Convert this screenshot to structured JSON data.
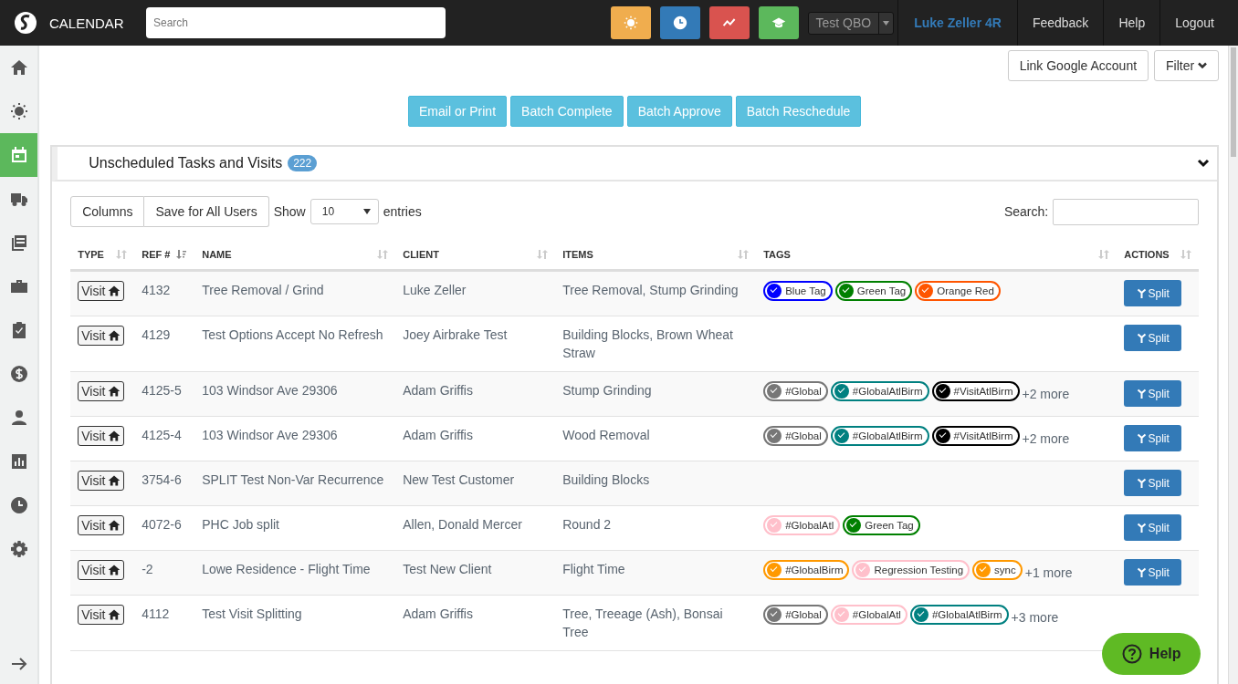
{
  "topbar": {
    "title": "CALENDAR",
    "search": {
      "placeholder": "Search"
    },
    "quick_buttons": [
      {
        "kind": "sun",
        "color": "#f0ad4e"
      },
      {
        "kind": "clock",
        "color": "#337ab7"
      },
      {
        "kind": "trend",
        "color": "#d9534f"
      },
      {
        "kind": "cap",
        "color": "#5cb85c"
      }
    ],
    "company_select": "Test QBO",
    "user": "Luke Zeller 4R",
    "links": [
      "Feedback",
      "Help",
      "Logout"
    ]
  },
  "sidebar": {
    "items": [
      {
        "kind": "home",
        "selected": false
      },
      {
        "kind": "sun",
        "selected": false
      },
      {
        "kind": "calendar",
        "selected": true
      },
      {
        "kind": "truck",
        "selected": false
      },
      {
        "kind": "book",
        "selected": false
      },
      {
        "kind": "briefcase",
        "selected": false
      },
      {
        "kind": "clipboard",
        "selected": false
      },
      {
        "kind": "dollar",
        "selected": false
      },
      {
        "kind": "person",
        "selected": false
      },
      {
        "kind": "chart",
        "selected": false
      },
      {
        "kind": "clock",
        "selected": false
      },
      {
        "kind": "gear",
        "selected": false
      }
    ]
  },
  "header_buttons": [
    "Link Google Account",
    "Filter"
  ],
  "batch_buttons": [
    "Email or Print",
    "Batch Complete",
    "Batch Approve",
    "Batch Reschedule"
  ],
  "panel": {
    "title": "Unscheduled Tasks and Visits",
    "count": "222",
    "expanded": true,
    "toolbar": {
      "buttons": [
        "Columns",
        "Save for All Users"
      ],
      "show_label": "Show",
      "page_size": "10",
      "entries_label": "entries",
      "search_label": "Search:"
    },
    "table": {
      "columns": [
        {
          "label": "TYPE",
          "sorted": false
        },
        {
          "label": "REF #",
          "sorted": true
        },
        {
          "label": "NAME",
          "sorted": false
        },
        {
          "label": "CLIENT",
          "sorted": false
        },
        {
          "label": "ITEMS",
          "sorted": false
        },
        {
          "label": "TAGS",
          "sorted": false
        },
        {
          "label": "ACTIONS",
          "sorted": false
        }
      ],
      "rows": [
        {
          "type": "Visit",
          "ref": "4132",
          "name": "Tree Removal / Grind",
          "client": "Luke Zeller",
          "items": "Tree Removal, Stump Grinding",
          "tags": [
            {
              "label": "Blue Tag",
              "color": "#0000ff"
            },
            {
              "label": "Green Tag",
              "color": "#008000"
            },
            {
              "label": "Orange Red",
              "color": "#ff5500"
            }
          ],
          "action": "Split"
        },
        {
          "type": "Visit",
          "ref": "4129",
          "name": "Test Options Accept No Refresh",
          "client": "Joey Airbrake Test",
          "items": "Building Blocks, Brown Wheat Straw",
          "action": "Split"
        },
        {
          "type": "Visit",
          "ref": "4125-5",
          "name": "103 Windsor Ave 29306",
          "client": "Adam Griffis",
          "items": "Stump Grinding",
          "tags": [
            {
              "label": "#Global",
              "color": "#777777"
            },
            {
              "label": "#GlobalAtlBirm",
              "color": "#008080"
            },
            {
              "label": "#VisitAtlBirm",
              "color": "#000000"
            }
          ],
          "more": "+2 more",
          "action": "Split"
        },
        {
          "type": "Visit",
          "ref": "4125-4",
          "name": "103 Windsor Ave 29306",
          "client": "Adam Griffis",
          "items": "Wood Removal",
          "tags": [
            {
              "label": "#Global",
              "color": "#777777"
            },
            {
              "label": "#GlobalAtlBirm",
              "color": "#008080"
            },
            {
              "label": "#VisitAtlBirm",
              "color": "#000000"
            }
          ],
          "more": "+2 more",
          "action": "Split"
        },
        {
          "type": "Visit",
          "ref": "3754-6",
          "name": "SPLIT Test Non-Var Recurrence",
          "client": "New Test Customer",
          "items": "Building Blocks",
          "action": "Split"
        },
        {
          "type": "Visit",
          "ref": "4072-6",
          "name": "PHC Job split",
          "client": "Allen, Donald Mercer",
          "items": "Round 2",
          "tags": [
            {
              "label": "#GlobalAtl",
              "color": "#ffc0cb"
            },
            {
              "label": "Green Tag",
              "color": "#008000"
            }
          ],
          "action": "Split"
        },
        {
          "type": "Visit",
          "ref": "-2",
          "name": "Lowe Residence - Flight Time",
          "client": "Test New Client",
          "items": "Flight Time",
          "tags": [
            {
              "label": "#GlobalBirm",
              "color": "#ff9900"
            },
            {
              "label": "Regression Testing",
              "color": "#ffc0cb"
            },
            {
              "label": "sync",
              "color": "#ff9900"
            }
          ],
          "more": "+1 more",
          "action": "Split"
        },
        {
          "type": "Visit",
          "ref": "4112",
          "name": "Test Visit Splitting",
          "client": "Adam Griffis",
          "items": "Tree, Treeage (Ash), Bonsai Tree",
          "tags": [
            {
              "label": "#Global",
              "color": "#777777"
            },
            {
              "label": "#GlobalAtl",
              "color": "#ffc0cb"
            },
            {
              "label": "#GlobalAtlBirm",
              "color": "#008080"
            }
          ],
          "more": "+3 more"
        }
      ]
    }
  },
  "help_button": "Help"
}
